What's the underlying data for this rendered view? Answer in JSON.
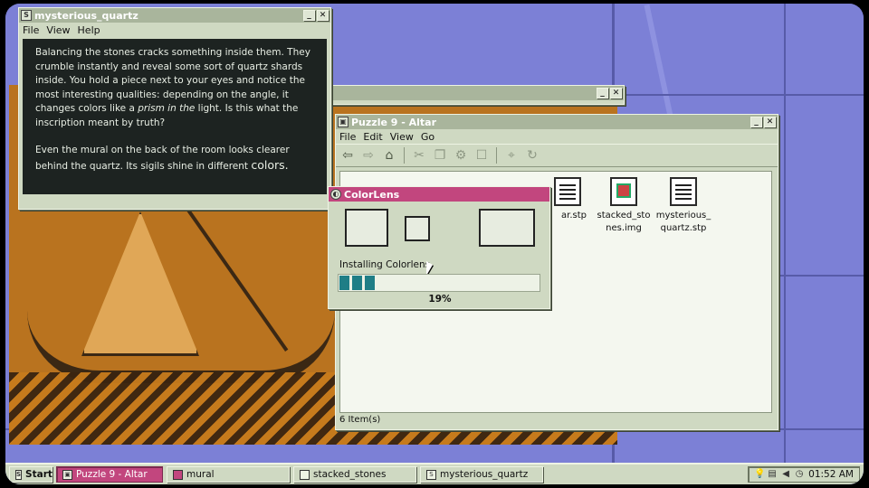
{
  "text_window": {
    "title": "mysterious_quartz",
    "menu": [
      "File",
      "View",
      "Help"
    ],
    "paragraph1_a": "Balancing the stones cracks something inside them. They crumble instantly and reveal some sort of quartz shards inside. You hold a piece next to your eyes and notice the most interesting qualities: depending on the angle, it changes colors like a",
    "paragraph1_em": "prism in the",
    "paragraph1_b": "light. Is this what the inscription meant by truth?",
    "paragraph2_a": "Even the mural on the back of the room looks clearer behind the quartz. Its sigils shine in different",
    "paragraph2_big": "colors."
  },
  "explorer": {
    "title": "Puzzle 9 - Altar",
    "menu": [
      "File",
      "Edit",
      "View",
      "Go"
    ],
    "files": [
      {
        "label": "ar.stp",
        "icon": "document-icon"
      },
      {
        "label": "stacked_sto nes.img",
        "icon": "image-file-icon"
      },
      {
        "label": "mysterious_ quartz.stp",
        "icon": "document-icon"
      }
    ],
    "status": "6 Item(s)"
  },
  "dialog": {
    "title": "ColorLens",
    "progress_label": "Installing Colorlens",
    "progress_percent": 19,
    "progress_text": "19%"
  },
  "taskbar": {
    "start": "Start",
    "tasks": [
      "Puzzle 9 - Altar",
      "mural",
      "stacked_stones",
      "mysterious_quartz"
    ],
    "time": "01:52 AM"
  },
  "colors": {
    "accent": "#c2467e",
    "window": "#cfd9c2",
    "desktop": "#6f73c8",
    "progress": "#1f7e86"
  }
}
